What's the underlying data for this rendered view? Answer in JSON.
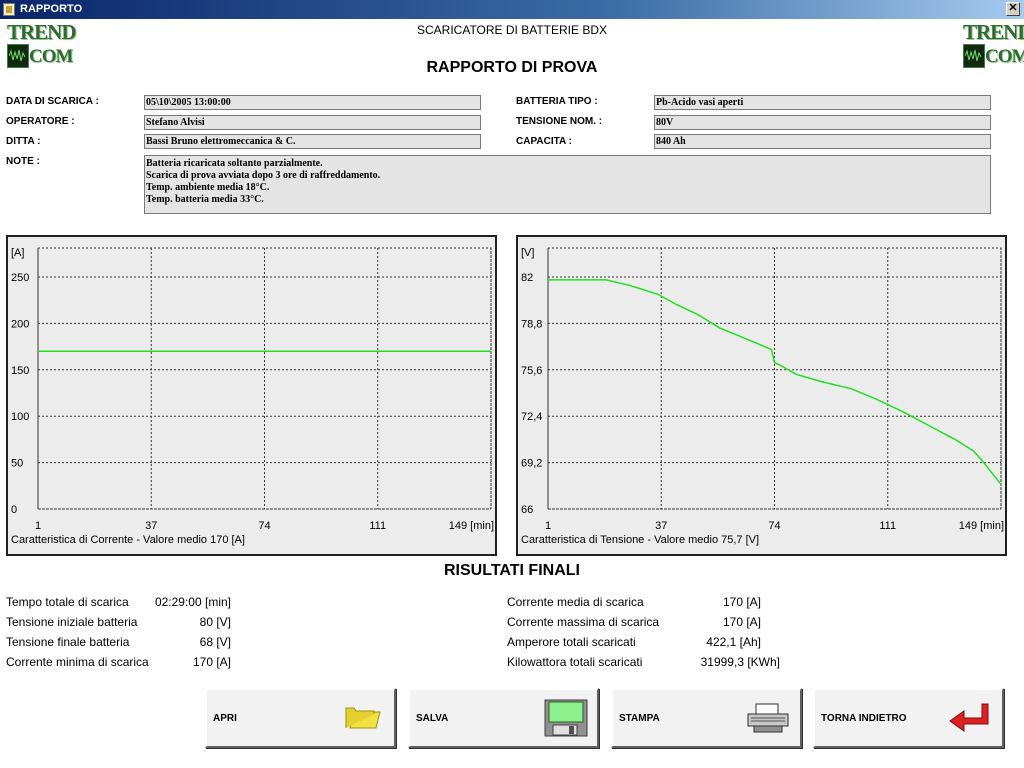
{
  "window": {
    "title": "RAPPORTO",
    "close_glyph": "✕"
  },
  "logo": {
    "top": "TREND",
    "bottom": "COM"
  },
  "app_title": "SCARICATORE DI BATTERIE BDX",
  "report_title": "RAPPORTO DI PROVA",
  "fields": {
    "data_label": "DATA DI SCARICA :",
    "data_value": "05\\10\\2005 13:00:00",
    "operatore_label": "OPERATORE :",
    "operatore_value": "Stefano Alvisi",
    "ditta_label": "DITTA :",
    "ditta_value": "Bassi Bruno elettromeccanica & C.",
    "note_label": "NOTE :",
    "batteria_label": "BATTERIA TIPO :",
    "batteria_value": "Pb-Acido vasi aperti",
    "tensione_label": "TENSIONE NOM. :",
    "tensione_value": "80V",
    "capacita_label": "CAPACITA :",
    "capacita_value": "840 Ah"
  },
  "notes": [
    "Batteria ricaricata soltanto parzialmente.",
    "Scarica di prova avviata dopo 3 ore di raffreddamento.",
    "Temp. ambiente media 18°C.",
    "Temp. batteria media 33°C."
  ],
  "chart_data": [
    {
      "type": "line",
      "title": "Caratteristica di Corrente - Valore medio 170 [A]",
      "ylabel": "[A]",
      "xlabel": "[min]",
      "x_ticks": [
        "1",
        "37",
        "74",
        "111",
        "149 [min]"
      ],
      "y_ticks": [
        "0",
        "50",
        "100",
        "150",
        "200",
        "250"
      ],
      "xlim": [
        1,
        149
      ],
      "ylim": [
        0,
        250
      ],
      "grid": true,
      "color": "#22dd22",
      "series": [
        {
          "x": [
            1,
            37,
            74,
            111,
            149
          ],
          "y": [
            170,
            170,
            170,
            170,
            170
          ]
        }
      ]
    },
    {
      "type": "line",
      "title": "Caratteristica di Tensione - Valore medio 75,7 [V]",
      "ylabel": "[V]",
      "xlabel": "[min]",
      "x_ticks": [
        "1",
        "37",
        "74",
        "111",
        "149 [min]"
      ],
      "y_ticks": [
        "66",
        "69,2",
        "72,4",
        "75,6",
        "78,8",
        "82"
      ],
      "xlim": [
        1,
        149
      ],
      "ylim": [
        66,
        82
      ],
      "grid": true,
      "color": "#22dd22",
      "series": [
        {
          "x": [
            1,
            20,
            28,
            37,
            43,
            50,
            57,
            65,
            74,
            75,
            77,
            82,
            90,
            100,
            108,
            117,
            125,
            134,
            140,
            143,
            146,
            149
          ],
          "y": [
            81.8,
            81.8,
            81.4,
            80.8,
            80.1,
            79.4,
            78.5,
            77.8,
            77.0,
            76.1,
            75.9,
            75.3,
            74.8,
            74.3,
            73.6,
            72.7,
            71.8,
            70.8,
            70.0,
            69.3,
            68.5,
            67.7
          ]
        }
      ]
    }
  ],
  "results": {
    "title": "RISULTATI FINALI",
    "left": [
      {
        "label": "Tempo totale di scarica",
        "value": "02:29:00 [min]"
      },
      {
        "label": "Tensione iniziale batteria",
        "value": "80 [V]"
      },
      {
        "label": "Tensione finale batteria",
        "value": "68 [V]"
      },
      {
        "label": "Corrente minima di scarica",
        "value": "170 [A]"
      }
    ],
    "right": [
      {
        "label": "Corrente media di scarica",
        "value": "170 [A]"
      },
      {
        "label": "Corrente massima di scarica",
        "value": "170 [A]"
      },
      {
        "label": "Amperore totali scaricati",
        "value": "422,1 [Ah]"
      },
      {
        "label": "Kilowattora totali scaricati",
        "value": "31999,3 [KWh]"
      }
    ]
  },
  "buttons": [
    {
      "label": "APRI",
      "icon": "folder-icon"
    },
    {
      "label": "SALVA",
      "icon": "floppy-disk-icon"
    },
    {
      "label": "STAMPA",
      "icon": "printer-icon"
    },
    {
      "label": "TORNA INDIETRO",
      "icon": "return-arrow-icon"
    }
  ]
}
